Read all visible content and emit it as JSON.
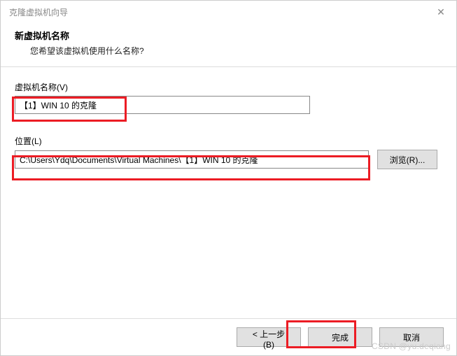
{
  "window": {
    "title": "克隆虚拟机向导",
    "close_glyph": "✕"
  },
  "header": {
    "title": "新虚拟机名称",
    "subtitle": "您希望该虚拟机使用什么名称?"
  },
  "fields": {
    "name_label": "虚拟机名称(V)",
    "name_value": "【1】WIN 10 的克隆",
    "location_label": "位置(L)",
    "location_value": "C:\\Users\\Ydq\\Documents\\Virtual Machines\\【1】WIN 10 的克隆",
    "browse_label": "浏览(R)..."
  },
  "footer": {
    "back_label": "< 上一步(B)",
    "finish_label": "完成",
    "cancel_label": "取消"
  },
  "watermark": "CSDN @yu.deqiang"
}
